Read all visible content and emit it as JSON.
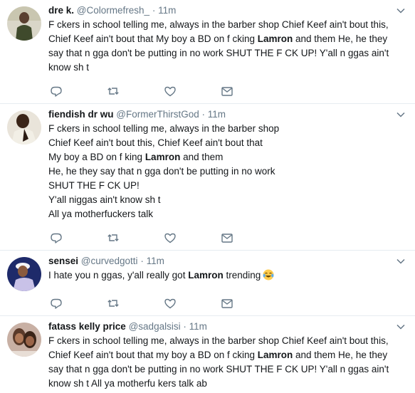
{
  "tweets": [
    {
      "name": "dre k.",
      "handle": "@Colormefresh_",
      "time": "11m",
      "text_segments": [
        {
          "t": "F  ckers in school telling me, always in the barber shop Chief Keef ain't bout this,\nChief Keef ain't bout that My boy a BD on f  cking ",
          "b": false
        },
        {
          "t": "Lamron",
          "b": true
        },
        {
          "t": " and them He, he they\nsay that n  gga don't be putting in no work SHUT THE F  CK UP! Y'all n  ggas ain't\nknow sh  t",
          "b": false
        }
      ]
    },
    {
      "name": "fiendish dr wu",
      "handle": "@FormerThirstGod",
      "time": "11m",
      "text_segments": [
        {
          "t": "F  ckers in school telling me, always in the barber shop\nChief Keef ain't bout this, Chief Keef ain't bout that\nMy boy a BD on f  king ",
          "b": false
        },
        {
          "t": "Lamron",
          "b": true
        },
        {
          "t": " and them\nHe, he they say that n  gga don't be putting in no work\nSHUT THE F  CK UP!\nY'all niggas ain't know sh  t\nAll ya motherfuckers talk",
          "b": false
        }
      ]
    },
    {
      "name": "sensei",
      "handle": "@curvedgotti",
      "time": "11m",
      "text_segments": [
        {
          "t": "I hate you n  ggas, y'all really got ",
          "b": false
        },
        {
          "t": "Lamron",
          "b": true
        },
        {
          "t": " trending",
          "b": false
        }
      ],
      "emoji": "tears-of-joy"
    },
    {
      "name": "fatass kelly price",
      "handle": "@sadgalsisi",
      "time": "11m",
      "text_segments": [
        {
          "t": "F  ckers in school telling me, always in the barber shop Chief Keef ain't bout this,\nChief Keef ain't bout that my boy a BD on f  cking ",
          "b": false
        },
        {
          "t": "Lamron",
          "b": true
        },
        {
          "t": " and them He, he they\nsay that n  gga don't be putting in no work SHUT THE F  CK UP! Y'all n  ggas ain't\nknow sh  t All ya motherfu  kers talk ab",
          "b": false
        }
      ]
    }
  ],
  "actions": [
    "reply-icon",
    "retweet-icon",
    "like-icon",
    "direct-message-icon"
  ],
  "colors": {
    "text": "#14171a",
    "muted": "#657786",
    "icon": "#657786",
    "divider": "#e6ecf0"
  }
}
